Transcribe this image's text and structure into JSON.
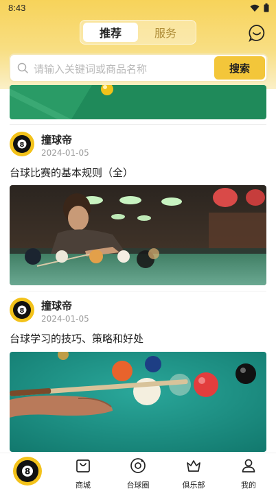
{
  "status_bar": {
    "time": "8:43"
  },
  "header": {
    "tabs": [
      {
        "label": "推荐",
        "active": true
      },
      {
        "label": "服务",
        "active": false
      }
    ]
  },
  "search": {
    "placeholder": "请输入关键词或商品名称",
    "button_label": "搜索"
  },
  "posts": [
    {
      "author": "撞球帝",
      "date": "2024-01-05",
      "title": "台球比赛的基本规则（全）"
    },
    {
      "author": "撞球帝",
      "date": "2024-01-05",
      "title": "台球学习的技巧、策略和好处"
    }
  ],
  "bottom_nav": {
    "items": [
      {
        "label": "商城",
        "icon": "shop-bag-icon"
      },
      {
        "label": "台球圈",
        "icon": "target-circle-icon"
      },
      {
        "label": "俱乐部",
        "icon": "crown-icon"
      },
      {
        "label": "我的",
        "icon": "user-icon"
      }
    ]
  },
  "colors": {
    "accent": "#f3c63a",
    "header_top": "#f7d35a",
    "table_green": "#1f8a5a"
  }
}
